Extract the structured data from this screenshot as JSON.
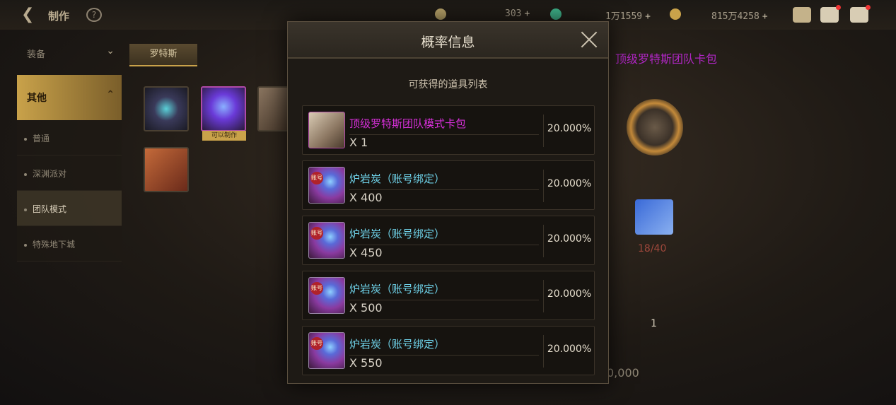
{
  "topbar": {
    "back_icon": "back-arrow-icon",
    "title": "制作",
    "currencies": [
      {
        "icon": "moon-coin-icon",
        "value": "303",
        "plus": "+"
      },
      {
        "icon": "green-gem-icon",
        "value": "1万1559",
        "plus": "+"
      },
      {
        "icon": "gold-coin-icon",
        "value": "815万4258",
        "plus": "+"
      }
    ],
    "icons": [
      "hat-icon",
      "mail-icon",
      "chat-icon"
    ]
  },
  "sidebar": {
    "header": "装备",
    "category": "其他",
    "items": [
      {
        "label": "普通",
        "active": false
      },
      {
        "label": "深渊派对",
        "active": false
      },
      {
        "label": "团队模式",
        "active": true
      },
      {
        "label": "特殊地下城",
        "active": false
      }
    ]
  },
  "subtab": {
    "label": "罗特斯"
  },
  "grid": {
    "tag": "可以制作"
  },
  "right": {
    "title": "顶级罗特斯团队卡包",
    "count": "18/40",
    "qty": "1",
    "cost": "0,000"
  },
  "modal": {
    "title": "概率信息",
    "subtitle": "可获得的道具列表",
    "items": [
      {
        "name": "顶级罗特斯团队模式卡包",
        "qty": "X 1",
        "pct": "20.000%",
        "style": "pink",
        "icon": "card-box-icon"
      },
      {
        "name": "炉岩炭（账号绑定）",
        "qty": "X 400",
        "pct": "20.000%",
        "style": "cyan",
        "icon": "lava-coal-icon"
      },
      {
        "name": "炉岩炭（账号绑定）",
        "qty": "X 450",
        "pct": "20.000%",
        "style": "cyan",
        "icon": "lava-coal-icon"
      },
      {
        "name": "炉岩炭（账号绑定）",
        "qty": "X 500",
        "pct": "20.000%",
        "style": "cyan",
        "icon": "lava-coal-icon"
      },
      {
        "name": "炉岩炭（账号绑定）",
        "qty": "X 550",
        "pct": "20.000%",
        "style": "cyan",
        "icon": "lava-coal-icon"
      }
    ],
    "stamp_text": "账号"
  }
}
